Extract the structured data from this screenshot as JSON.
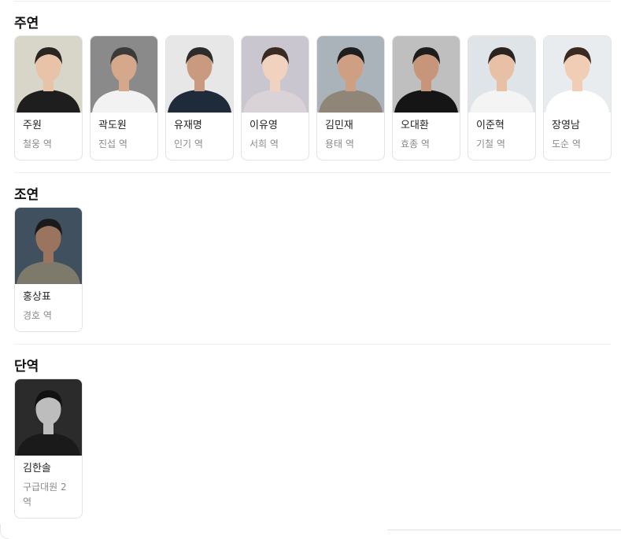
{
  "sections": [
    {
      "title": "주연",
      "cast": [
        {
          "name": "주원",
          "role": "철웅 역",
          "bg": "#d8d6c9",
          "skin": "#e9c3a7",
          "hair": "#2a2522",
          "shirt": "#1e1e1e"
        },
        {
          "name": "곽도원",
          "role": "진섭 역",
          "bg": "#8a8a8a",
          "skin": "#d6a88b",
          "hair": "#3a3a3a",
          "shirt": "#f2f2f2"
        },
        {
          "name": "유재명",
          "role": "인기 역",
          "bg": "#e7e7e7",
          "skin": "#c99a80",
          "hair": "#2c2c2c",
          "shirt": "#1f2a3a"
        },
        {
          "name": "이유영",
          "role": "서희 역",
          "bg": "#c9c6cf",
          "skin": "#f1d2bf",
          "hair": "#3a2a24",
          "shirt": "#d9d2d6"
        },
        {
          "name": "김민재",
          "role": "용태 역",
          "bg": "#a9b3b9",
          "skin": "#cf9f84",
          "hair": "#1e1e1e",
          "shirt": "#8f8578"
        },
        {
          "name": "오대환",
          "role": "효종 역",
          "bg": "#bfbfbf",
          "skin": "#c7957a",
          "hair": "#1d1d1d",
          "shirt": "#151515"
        },
        {
          "name": "이준혁",
          "role": "기철 역",
          "bg": "#dfe4e8",
          "skin": "#e7c0a6",
          "hair": "#2b2320",
          "shirt": "#f4f4f4"
        },
        {
          "name": "장영남",
          "role": "도순 역",
          "bg": "#e9ecef",
          "skin": "#f1cdb6",
          "hair": "#3a2a22",
          "shirt": "#ffffff"
        }
      ]
    },
    {
      "title": "조연",
      "cast": [
        {
          "name": "홍상표",
          "role": "경호 역",
          "bg": "#41505f",
          "skin": "#9b7460",
          "hair": "#1a1a1a",
          "shirt": "#7d7a6c"
        }
      ]
    },
    {
      "title": "단역",
      "cast": [
        {
          "name": "김한솔",
          "role": "구급대원 2 역",
          "bg": "#2b2b2b",
          "skin": "#bdbdbd",
          "hair": "#111111",
          "shirt": "#1a1a1a"
        }
      ]
    }
  ]
}
